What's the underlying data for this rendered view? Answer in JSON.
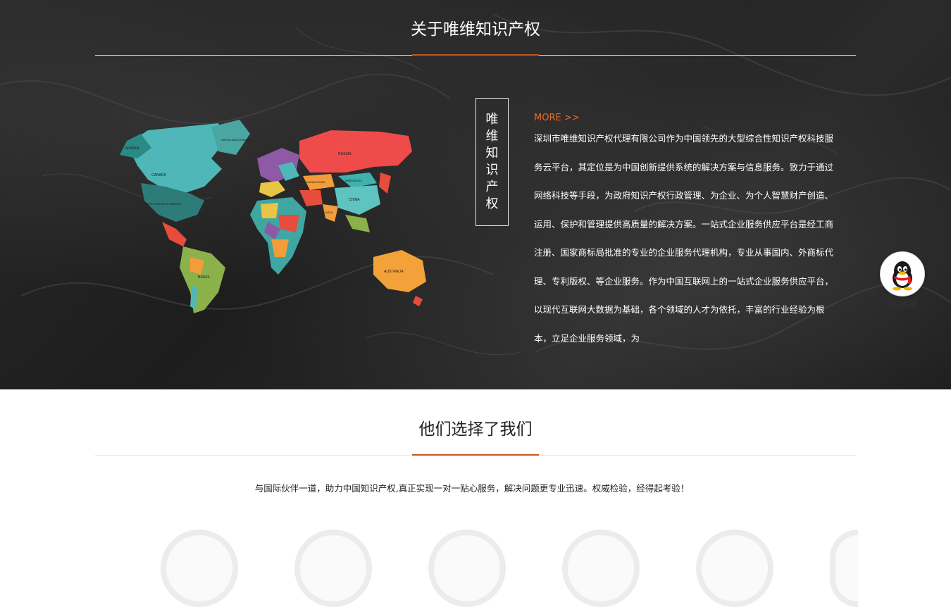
{
  "about": {
    "title": "关于唯维知识产权",
    "vertical_label": "唯维知识产权",
    "more_link": "MORE >>",
    "description": "深圳市唯维知识产权代理有限公司作为中国领先的大型综合性知识产权科技服务云平台，其定位是为中国创新提供系统的解决方案与信息服务。致力于通过网络科技等手段，为政府知识产权行政管理、为企业、为个人智慧财产创造、运用、保护和管理提供高质量的解决方案。一站式企业服务供应平台是经工商注册、国家商标局批准的专业的企业服务代理机构，专业从事国内、外商标代理、专利版权、等企业服务。作为中国互联网上的一站式企业服务供应平台，以现代互联网大数据为基础，各个领域的人才为依托，丰富的行业经验为根本，立足企业服务领域，为"
  },
  "map_labels": {
    "canada": "CANADA",
    "usa": "UNITED STATES OF AMERICA",
    "greenland": "GREENLAND (DENMARK)",
    "alaska": "ALASKA",
    "brazil": "BRAZIL",
    "russia": "RUSSIA",
    "kazakhstan": "KAZAKHSTAN",
    "mongolia": "MONGOLIA",
    "china": "CHINA",
    "india": "INDIA",
    "australia": "AUSTRALIA"
  },
  "qq": {
    "label": "QQ客服"
  },
  "clients": {
    "title": "他们选择了我们",
    "subtitle": "与国际伙伴一道，助力中国知识产权,真正实现一对一贴心服务，解决问题更专业迅速。权威检验，经得起考验！"
  },
  "colors": {
    "accent": "#f26a21",
    "rule_accent": "#c8521e"
  }
}
